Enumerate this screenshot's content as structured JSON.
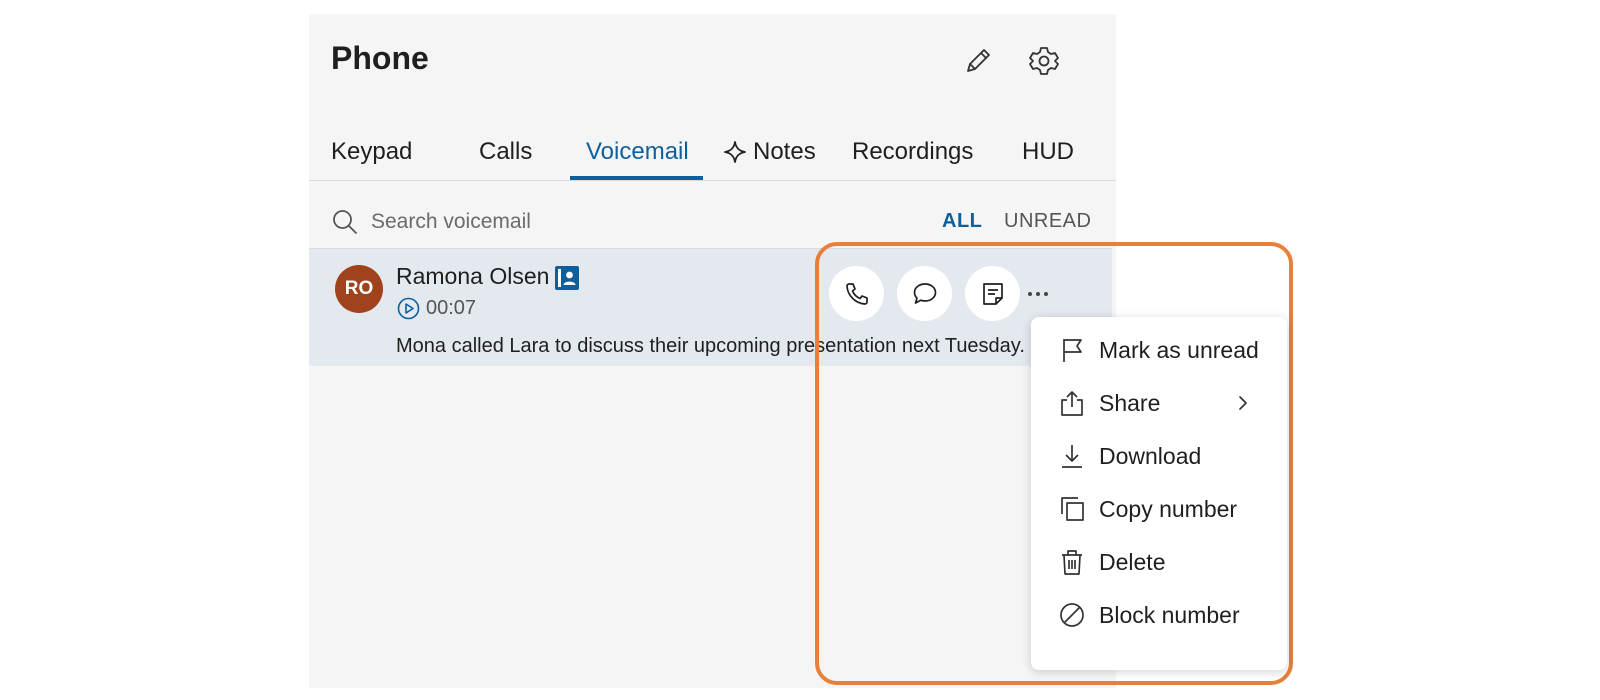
{
  "app": {
    "title": "Phone"
  },
  "header_icons": [
    "pencil-icon",
    "gear-icon"
  ],
  "tabs": [
    {
      "label": "Keypad",
      "active": false
    },
    {
      "label": "Calls",
      "active": false
    },
    {
      "label": "Voicemail",
      "active": true
    },
    {
      "label": "Notes",
      "active": false,
      "icon": "sparkle-icon"
    },
    {
      "label": "Recordings",
      "active": false
    },
    {
      "label": "HUD",
      "active": false
    }
  ],
  "search": {
    "placeholder": "Search voicemail",
    "value": ""
  },
  "filters": {
    "all": "ALL",
    "unread": "UNREAD",
    "selected": "ALL"
  },
  "voicemail": {
    "avatar_initials": "RO",
    "avatar_color": "#a0421b",
    "caller": "Ramona Olsen",
    "duration": "00:07",
    "transcript": "Mona called Lara to discuss their upcoming presentation next Tuesday.",
    "actions": [
      "phone-icon",
      "chat-icon",
      "note-icon",
      "more-icon"
    ]
  },
  "menu": {
    "items": [
      {
        "label": "Mark as unread",
        "icon": "flag-icon"
      },
      {
        "label": "Share",
        "icon": "share-icon",
        "submenu": true
      },
      {
        "label": "Download",
        "icon": "download-icon"
      },
      {
        "label": "Copy number",
        "icon": "copy-icon"
      },
      {
        "label": "Delete",
        "icon": "trash-icon"
      },
      {
        "label": "Block number",
        "icon": "block-icon"
      }
    ]
  },
  "colors": {
    "accent": "#0e5f9e",
    "highlight": "#e8803a",
    "row_selected": "#e3e9ef"
  }
}
